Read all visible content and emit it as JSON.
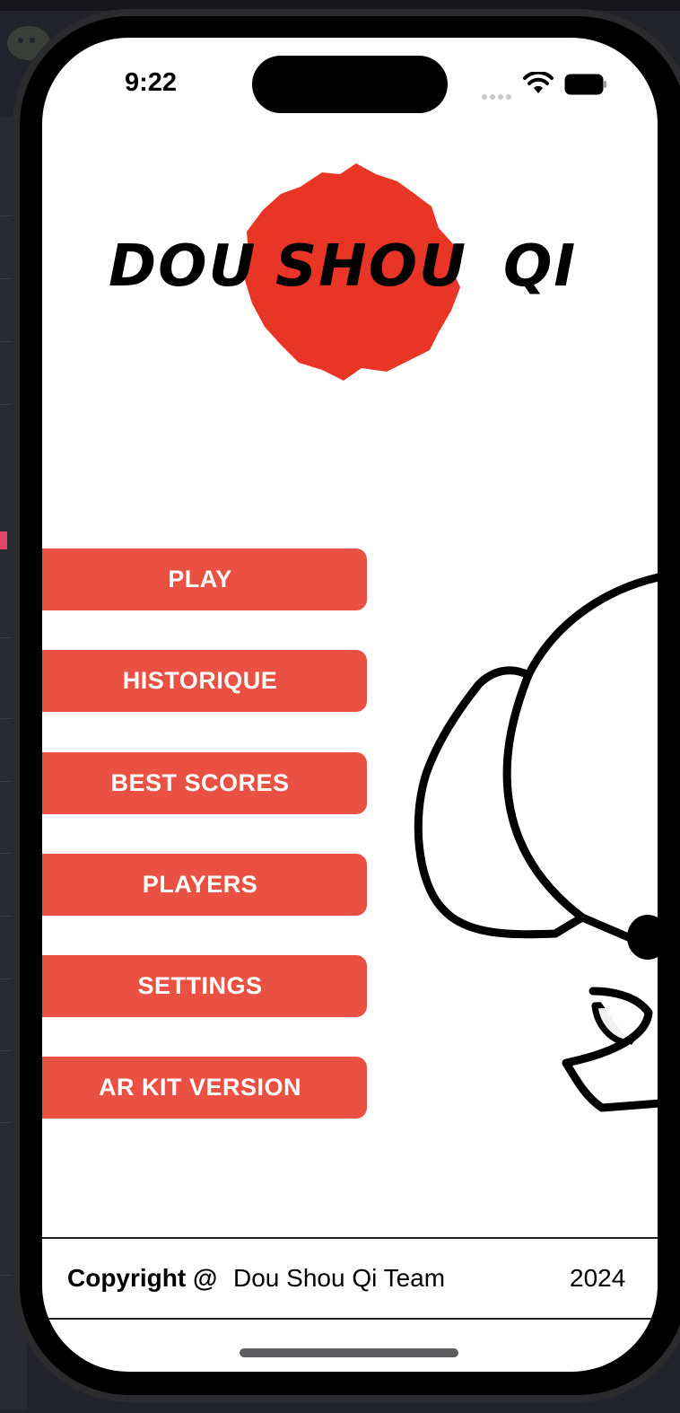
{
  "status_bar": {
    "time": "9:22"
  },
  "logo": {
    "words": [
      "DOU",
      "SHOU",
      "QI"
    ],
    "splash_color": "#e83526"
  },
  "menu": {
    "buttons": [
      {
        "label": "PLAY"
      },
      {
        "label": "HISTORIQUE"
      },
      {
        "label": "BEST SCORES"
      },
      {
        "label": "PLAYERS"
      },
      {
        "label": "SETTINGS"
      },
      {
        "label": "AR KIT VERSION"
      }
    ],
    "button_color": "#eb5142"
  },
  "footer": {
    "copyright_label": "Copyright @",
    "team": "Dou Shou Qi Team",
    "year": "2024"
  },
  "icons": {
    "status": [
      "wifi-icon",
      "battery-icon",
      "signal-dots-icon"
    ],
    "mascot": "elephant-illustration"
  }
}
